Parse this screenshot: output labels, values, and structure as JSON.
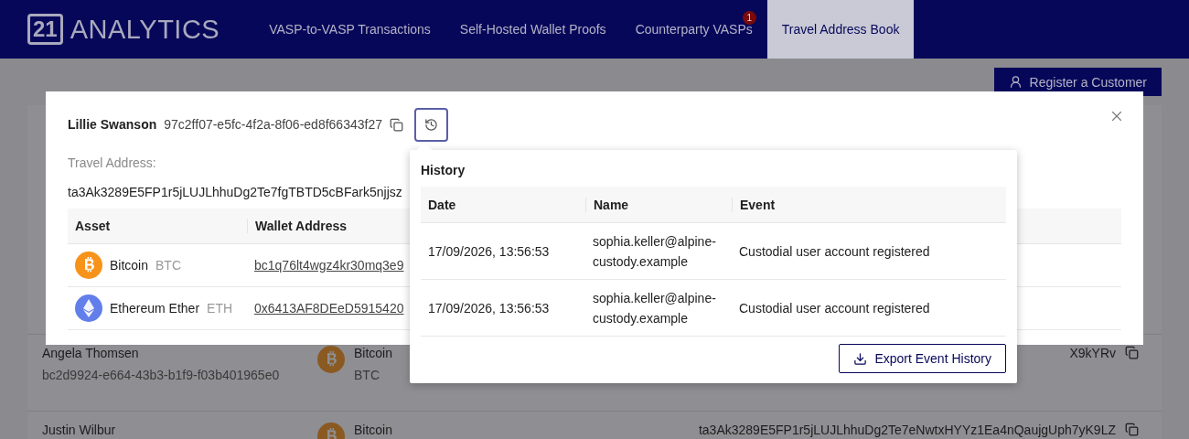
{
  "header": {
    "logo_number": "21",
    "logo_text": "ANALYTICS",
    "tabs": [
      {
        "label": "VASP-to-VASP Transactions",
        "selected": false
      },
      {
        "label": "Self-Hosted Wallet Proofs",
        "selected": false
      },
      {
        "label": "Counterparty VASPs",
        "selected": false,
        "badge": "1"
      },
      {
        "label": "Travel Address Book",
        "selected": true
      }
    ]
  },
  "register_button": "Register a Customer",
  "customers": [
    {
      "name": "Angela Thomsen",
      "id": "bc2d9924-e664-43b3-b1f9-f03b401965e0",
      "kind": "bitcoin",
      "asset": "Bitcoin",
      "symbol": "BTC",
      "travel_address": "X9kYRv"
    },
    {
      "name": "Justin Wilbur",
      "kind": "bitcoin",
      "asset": "Bitcoin",
      "travel_address": "ta3Ak3289E5FP1r5jLUJLhhuDg2Te7eNwtxHYYz1Ea4nQaujgUph7yK9LZ"
    }
  ],
  "modal": {
    "name": "Lillie Swanson",
    "id": "97c2ff07-e5fc-4f2a-8f06-ed8f66343f27",
    "travel_address_label": "Travel Address:",
    "travel_address": "ta3Ak3289E5FP1r5jLUJLhhuDg2Te7fgTBTD5cBFark5njjsz",
    "columns": [
      "Asset",
      "Wallet Address"
    ],
    "assets": [
      {
        "kind": "bitcoin",
        "name": "Bitcoin",
        "symbol": "BTC",
        "address": "bc1q76lt4wgz4kr30mq3e9"
      },
      {
        "kind": "ethereum",
        "name": "Ethereum Ether",
        "symbol": "ETH",
        "address": "0x6413AF8DEeD5915420"
      }
    ]
  },
  "history": {
    "title": "History",
    "columns": [
      "Date",
      "Name",
      "Event"
    ],
    "rows": [
      {
        "date": "17/09/2026, 13:56:53",
        "name": "sophia.keller@alpine-custody.example",
        "event": "Custodial user account registered"
      },
      {
        "date": "17/09/2026, 13:56:53",
        "name": "sophia.keller@alpine-custody.example",
        "event": "Custodial user account registered"
      }
    ],
    "export_button": "Export Event History"
  }
}
